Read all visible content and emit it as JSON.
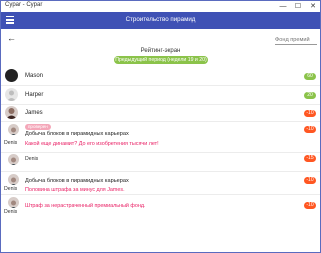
{
  "window": {
    "title": "Cypar - Cypar",
    "minimize": "—",
    "maximize": "☐",
    "close": "✕"
  },
  "appbar": {
    "title": "Строительство пирамид"
  },
  "toolbar": {
    "back": "←",
    "fund_placeholder": "Фонд премий"
  },
  "rating": {
    "label": "Рейтинг-экран",
    "period": "Предыдущий период (недели 19 и 20)"
  },
  "players": [
    {
      "name": "Mason",
      "score": "60",
      "avatar": "dark",
      "badge": "green"
    },
    {
      "name": "Harper",
      "score": "20",
      "avatar": "light",
      "badge": "green"
    },
    {
      "name": "James",
      "score": "-10",
      "avatar": "photo",
      "badge": "orange"
    }
  ],
  "feed": [
    {
      "author": "Denis",
      "tag": "проверен",
      "text": "Добыча блоков в пирамидных карьерах",
      "comment": "Какой еще динамит? До его изобретения тысячи лет!",
      "score": "-10"
    },
    {
      "author": "Denis",
      "tag": "",
      "text": "",
      "comment": "",
      "score": "-15"
    },
    {
      "author": "Denis",
      "tag": "",
      "text": "Добыча блоков в пирамидных карьерах",
      "comment": "Половина штрафа за минус для James.",
      "score": "-10"
    },
    {
      "author": "Denis",
      "tag": "",
      "text": "",
      "comment": "Штраф за нерастраченный премиальный фонд.",
      "score": "-10"
    }
  ]
}
